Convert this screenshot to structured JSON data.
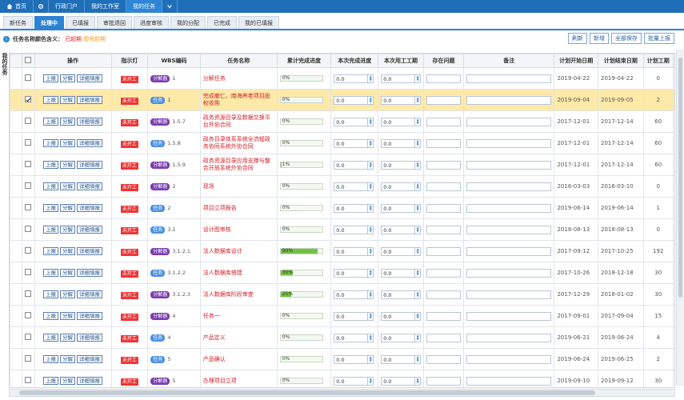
{
  "topnav": {
    "home": "首页",
    "portal": "行政门户",
    "workspace": "我的工作室",
    "tasks": "我的任务"
  },
  "tabs": [
    "新任务",
    "处理中",
    "已填报",
    "审批退回",
    "进度审核",
    "我的分配",
    "已完成",
    "我的已填报"
  ],
  "active_tab": 1,
  "toolbar": {
    "legend_label": "任务名称颜色含义：",
    "legend_overdue": "已超期",
    "legend_near": "即将超期",
    "refresh": "刷新",
    "add": "新增",
    "save_all": "全部保存",
    "batch_report": "批量上报"
  },
  "side_label": "我的任务",
  "columns": [
    "操作",
    "指示灯",
    "WBS编码",
    "任务名称",
    "累计完成进度",
    "本次完成进度",
    "本次用工工期",
    "存在问题",
    "备注",
    "计划开始日期",
    "计划结束日期",
    "计划工期",
    "任务级别",
    "所属项目",
    "发布人"
  ],
  "ops": [
    "上报",
    "分解",
    "详细填报"
  ],
  "indicator": "未开工",
  "badge_decomp": "分解器",
  "badge_task": "任务",
  "rows": [
    {
      "badge": "decomp",
      "wbs": "1",
      "name": "分解任务",
      "progress": "0%",
      "pct": 0,
      "cur": "0.0",
      "days": "0.0",
      "start": "2019-04-22",
      "end": "2019-04-22",
      "dur": "0",
      "level": "普通",
      "project": "a001",
      "sel": false
    },
    {
      "badge": "task",
      "wbs": "1",
      "name": "完成撤仁、南海养老项目股权收购",
      "progress": "0%",
      "pct": 0,
      "cur": "0.0",
      "days": "0.0",
      "start": "2019-09-04",
      "end": "2019-09-05",
      "dur": "2",
      "level": "重要",
      "project": "节点计划",
      "sel": true
    },
    {
      "badge": "decomp",
      "wbs": "1.5.7",
      "name": "政务资源目录及数据交换平台外协合同",
      "progress": "0%",
      "pct": 0,
      "cur": "0.0",
      "days": "0.0",
      "start": "2017-12-01",
      "end": "2017-12-14",
      "dur": "60",
      "level": "普通",
      "project": "郑州市政务信息资源目录体系建设项目",
      "sel": false
    },
    {
      "badge": "task",
      "wbs": "1.5.8",
      "name": "政务目录体系系统全流程政务协同系统外协合同",
      "progress": "0%",
      "pct": 0,
      "cur": "0.0",
      "days": "0.0",
      "start": "2017-12-01",
      "end": "2017-12-14",
      "dur": "60",
      "level": "普通",
      "project": "郑州市政务信息资源目录体系建设项目",
      "sel": false
    },
    {
      "badge": "decomp",
      "wbs": "1.5.9",
      "name": "政务资源目录应用支撑与整合开放系统外协合同",
      "progress": "1%",
      "pct": 1,
      "cur": "0.0",
      "days": "0.0",
      "start": "2017-12-01",
      "end": "2017-12-14",
      "dur": "60",
      "level": "普通",
      "project": "郑州市政务信息资源目录体系建设项目",
      "sel": false
    },
    {
      "badge": "decomp",
      "wbs": "2",
      "name": "现场",
      "progress": "0%",
      "pct": 0,
      "cur": "0.0",
      "days": "0.0",
      "start": "2016-03-03",
      "end": "2016-03-10",
      "dur": "0",
      "level": "普通",
      "project": "南宁大桥",
      "sel": false
    },
    {
      "badge": "task",
      "wbs": "2",
      "name": "项目立项报告",
      "progress": "0%",
      "pct": 0,
      "cur": "0.0",
      "days": "0.0",
      "start": "2019-06-14",
      "end": "2019-06-14",
      "dur": "1",
      "level": "普通",
      "project": "电子产品研发进度管理项目",
      "sel": false
    },
    {
      "badge": "task",
      "wbs": "3.1",
      "name": "设计图审核",
      "progress": "0%",
      "pct": 0,
      "cur": "0.0",
      "days": "0.0",
      "start": "2018-08-13",
      "end": "2018-08-13",
      "dur": "0",
      "level": "普通",
      "project": "测试汽车研发项目",
      "sel": false
    },
    {
      "badge": "decomp",
      "wbs": "3.1.2.1",
      "name": "法人数据库设计",
      "progress": "90%",
      "pct": 90,
      "cur": "0.0",
      "days": "0.0",
      "start": "2017-09-12",
      "end": "2017-10-25",
      "dur": "192",
      "level": "普通",
      "project": "郑州市政务信息资源目录体系建设项目",
      "sel": false
    },
    {
      "badge": "task",
      "wbs": "3.1.2.2",
      "name": "法人数据库搭建",
      "progress": "30%",
      "pct": 30,
      "cur": "0.0",
      "days": "0.0",
      "start": "2017-10-26",
      "end": "2018-12-18",
      "dur": "30",
      "level": "普通",
      "project": "郑州市政务信息资源目录体系建设项目",
      "sel": false
    },
    {
      "badge": "decomp",
      "wbs": "3.1.2.3",
      "name": "法人数据库阶段审查",
      "progress": "25%",
      "pct": 25,
      "cur": "0.0",
      "days": "0.0",
      "start": "2017-12-29",
      "end": "2018-01-02",
      "dur": "30",
      "level": "普通",
      "project": "郑州市政务信息资源目录体系建设项目",
      "sel": false
    },
    {
      "badge": "decomp",
      "wbs": "4",
      "name": "任务一",
      "progress": "0%",
      "pct": 0,
      "cur": "0.0",
      "days": "0.0",
      "start": "2017-09-01",
      "end": "2017-09-04",
      "dur": "15",
      "level": "普通",
      "project": "cgltest0131",
      "sel": false
    },
    {
      "badge": "task",
      "wbs": "4",
      "name": "产品定义",
      "progress": "0%",
      "pct": 0,
      "cur": "0.0",
      "days": "0.0",
      "start": "2019-06-21",
      "end": "2019-06-24",
      "dur": "4",
      "level": "普通",
      "project": "电子产品研发进度管理项目",
      "sel": false
    },
    {
      "badge": "task",
      "wbs": "5",
      "name": "产品确认",
      "progress": "0%",
      "pct": 0,
      "cur": "0.0",
      "days": "0.0",
      "start": "2019-06-24",
      "end": "2019-06-25",
      "dur": "2",
      "level": "普通",
      "project": "电子产品研发进度管理项目",
      "sel": false
    },
    {
      "badge": "decomp",
      "wbs": "5",
      "name": "办理项目立项",
      "progress": "0%",
      "pct": 0,
      "cur": "0.0",
      "days": "0.0",
      "start": "2019-09-10",
      "end": "2019-09-12",
      "dur": "30",
      "level": "普通",
      "project": "海珠数据规信息化项目管理流程",
      "sel": false
    },
    {
      "badge": "decomp",
      "wbs": "6",
      "name": "测试任务",
      "progress": "0%",
      "pct": 0,
      "cur": "0.0",
      "days": "0.0",
      "start": "2018-07-13",
      "end": "2018-07-18",
      "dur": "30",
      "level": "普通",
      "project": "多自由度潮融肩线系统",
      "sel": false
    }
  ]
}
